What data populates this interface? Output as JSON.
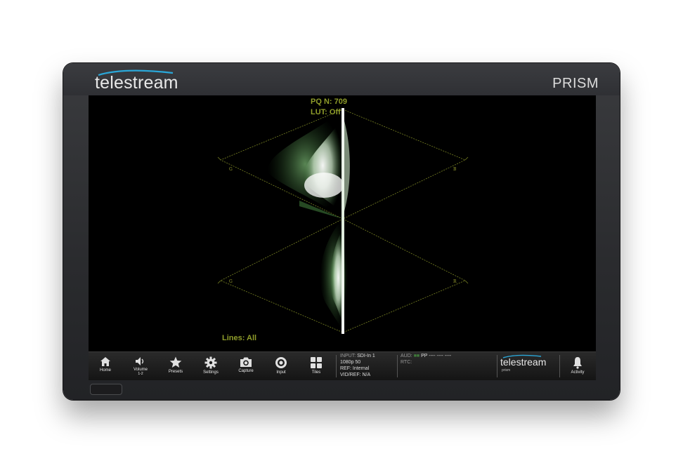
{
  "device": {
    "brand": "telestream",
    "model": "PRISM"
  },
  "display": {
    "overlay_mode": "PQ N: 709",
    "lut": "LUT: Off",
    "lines": "Lines: All",
    "corner_labels": {
      "g_top": "G",
      "b": "B",
      "g_bottom": "G",
      "r": "R"
    }
  },
  "toolbar": {
    "buttons": [
      {
        "label": "Home",
        "icon": "home-icon"
      },
      {
        "label": "Volume",
        "sub": "1-2",
        "icon": "speaker-icon"
      },
      {
        "label": "Presets",
        "icon": "star-icon"
      },
      {
        "label": "Settings",
        "icon": "gear-icon"
      },
      {
        "label": "Capture",
        "icon": "camera-icon"
      },
      {
        "label": "Input",
        "icon": "input-target-icon"
      },
      {
        "label": "Tiles",
        "icon": "tiles-icon"
      }
    ],
    "status": {
      "input_label": "INPUT:",
      "input_value": "SDI-In 1",
      "format": "1080p 50",
      "ref": "REF: Internal",
      "vidref": "VID/REF: N/A"
    },
    "audio": {
      "aud_label": "AUD:",
      "aud_value": "PP ---- ---- ----",
      "rtc_label": "RTC:"
    },
    "brand": "telestream",
    "brand_sub": "prism",
    "activity": {
      "label": "Activity",
      "icon": "bell-icon"
    }
  },
  "colors": {
    "overlay_text": "#8f9d2a",
    "graticule": "#7a8424",
    "trace": "#5a9a55",
    "swoosh": "#2aa7d8"
  }
}
